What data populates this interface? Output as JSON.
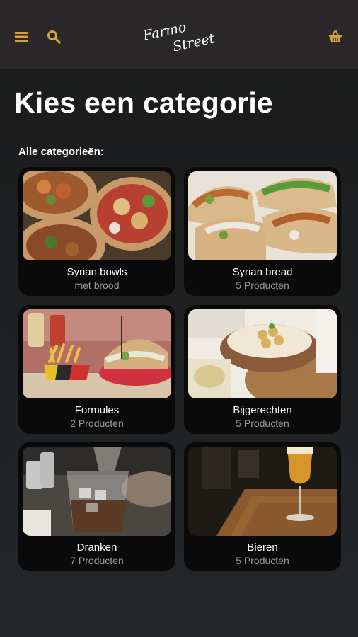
{
  "header": {
    "logo_text": "Farmo Street",
    "icons": {
      "menu": "menu-icon",
      "search": "search-icon",
      "cart": "basket-icon"
    },
    "icon_color": "#d4a13a"
  },
  "page": {
    "title": "Kies een categorie",
    "section_label": "Alle categorieën:"
  },
  "categories": [
    {
      "name": "Syrian bowls",
      "subtitle": "met brood"
    },
    {
      "name": "Syrian bread",
      "subtitle": "5 Producten"
    },
    {
      "name": "Formules",
      "subtitle": "2 Producten"
    },
    {
      "name": "Bijgerechten",
      "subtitle": "5 Producten"
    },
    {
      "name": "Dranken",
      "subtitle": "7 Producten"
    },
    {
      "name": "Bieren",
      "subtitle": "5 Producten"
    }
  ]
}
